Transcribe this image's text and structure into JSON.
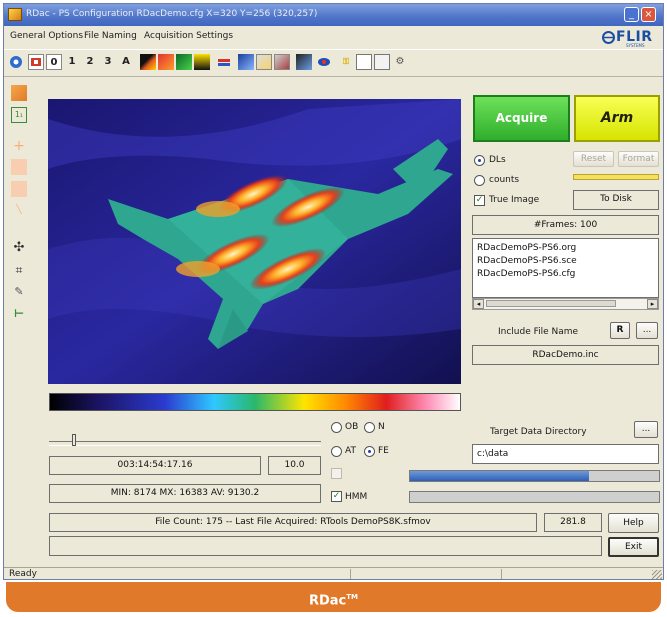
{
  "window": {
    "title": "RDac - PS Configuration RDacDemo.cfg  X=320  Y=256 (320,257)",
    "min_label": "_",
    "close_label": "×"
  },
  "menu": [
    "General Options",
    "File Naming",
    "Acquisition Settings"
  ],
  "logo": {
    "text": "FLIR",
    "sub": "SYSTEMS",
    "color": "#1b4fa3"
  },
  "toolbar": {
    "buttons": [
      {
        "name": "globe-icon",
        "label": ""
      },
      {
        "name": "camera-icon",
        "label": ""
      },
      {
        "name": "preset-0-button",
        "label": "0"
      },
      {
        "name": "preset-1-button",
        "label": "1"
      },
      {
        "name": "preset-2-button",
        "label": "2"
      },
      {
        "name": "preset-3-button",
        "label": "3"
      },
      {
        "name": "preset-a-button",
        "label": "A"
      }
    ]
  },
  "acquire_label": "Acquire",
  "arm_label": "Arm",
  "units": {
    "dl_label": "DLs",
    "counts_label": "counts"
  },
  "reset_label": "Reset",
  "format_label": "Format",
  "true_image_label": "True Image",
  "to_disk_label": "To Disk",
  "frames_label": "#Frames: 100",
  "files": [
    "RDacDemoPS-PS6.org",
    "RDacDemoPS-PS6.sce",
    "RDacDemoPS-PS6.cfg"
  ],
  "include_label": "Include File Name",
  "include_btn": "R",
  "include_btn2": "...",
  "include_value": "RDacDemo.inc",
  "target_label": "Target Data Directory",
  "target_btn": "...",
  "target_value": "c:\\data",
  "timestamp": "003:14:54:17.16",
  "value_field": "10.0",
  "stats": "MIN: 8174  MX: 16383  AV: 9130.2",
  "radios": {
    "ob": "OB",
    "n": "N",
    "at": "AT",
    "fe": "FE"
  },
  "hmm_label": "HMM",
  "file_count": "File Count: 175 -- Last File Acquired: RTools DemoPS8K.sfmov",
  "file_rate": "281.8",
  "help_label": "Help",
  "exit_label": "Exit",
  "status": "Ready",
  "progress": {
    "upper_fraction": 0.72,
    "lower_fraction": 0.0
  },
  "banner": {
    "text": "RDac",
    "tm": "TM"
  },
  "colors": {
    "acquire": "#3cc236",
    "arm": "#e6f000",
    "banner": "#e07a2a",
    "titlebar": "#4f74c8"
  }
}
